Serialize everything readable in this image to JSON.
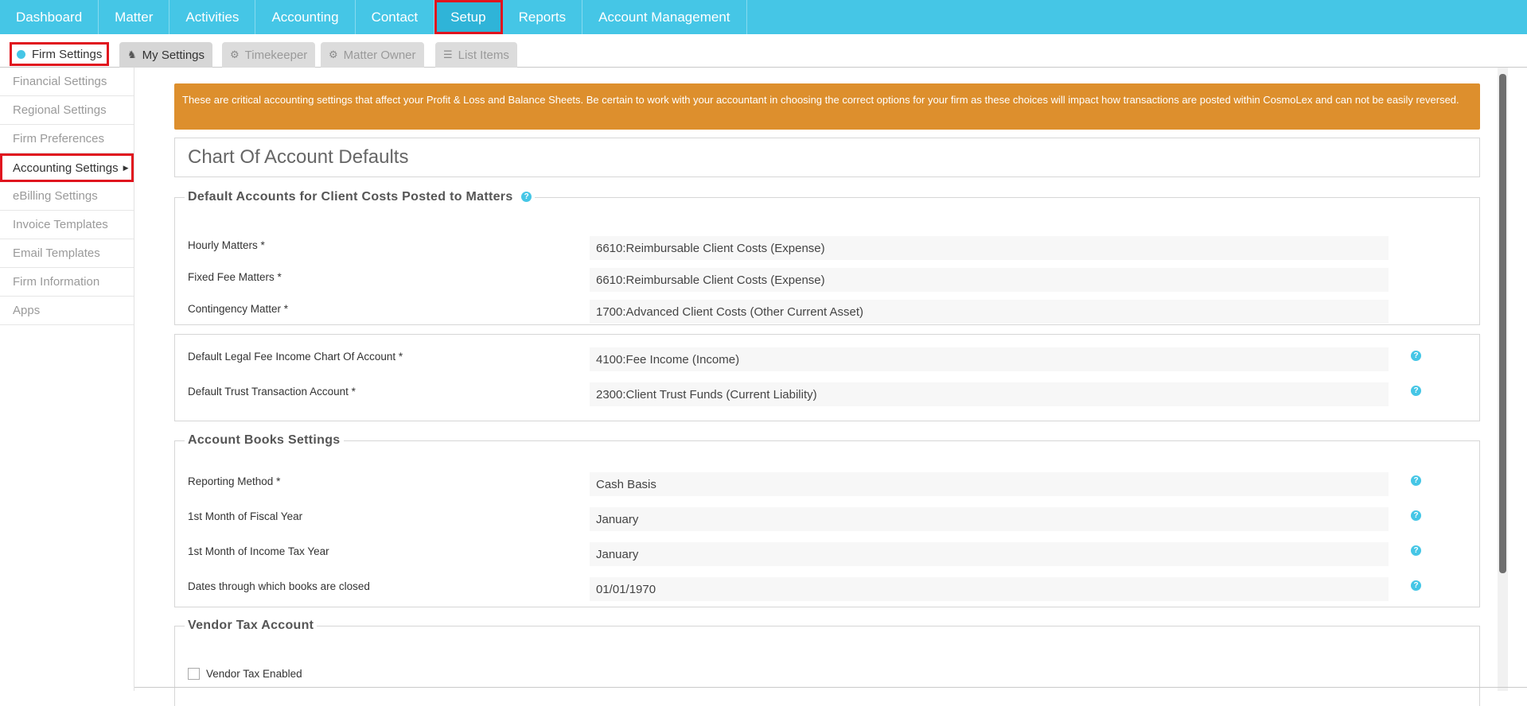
{
  "topnav": {
    "items": [
      "Dashboard",
      "Matter",
      "Activities",
      "Accounting",
      "Contact",
      "Setup",
      "Reports",
      "Account Management"
    ],
    "active": "Setup"
  },
  "subtabs": {
    "firm_settings": "Firm Settings",
    "my_settings": "My Settings",
    "timekeeper": "Timekeeper",
    "matter_owner": "Matter Owner",
    "list_items": "List Items"
  },
  "sidebar": {
    "items": [
      "Financial Settings",
      "Regional Settings",
      "Firm Preferences",
      "Accounting Settings",
      "eBilling Settings",
      "Invoice Templates",
      "Email Templates",
      "Firm Information",
      "Apps"
    ],
    "active": "Accounting Settings"
  },
  "warning": "These are critical accounting settings that affect your Profit & Loss and Balance Sheets. Be certain to work with your accountant in choosing the correct options for your firm as these choices will impact how transactions are posted within CosmoLex and can not be easily reversed.",
  "page_title": "Chart Of Account Defaults",
  "client_costs": {
    "legend": "Default Accounts for Client Costs Posted to Matters",
    "hourly_label": "Hourly Matters *",
    "hourly_value": "6610:Reimbursable Client Costs (Expense)",
    "fixed_label": "Fixed Fee Matters *",
    "fixed_value": "6610:Reimbursable Client Costs (Expense)",
    "contingency_label": "Contingency Matter *",
    "contingency_value": "1700:Advanced Client Costs (Other Current Asset)"
  },
  "defaults": {
    "legal_fee_label": "Default Legal Fee Income Chart Of Account *",
    "legal_fee_value": "4100:Fee Income (Income)",
    "trust_label": "Default Trust Transaction Account *",
    "trust_value": "2300:Client Trust Funds (Current Liability)"
  },
  "books": {
    "legend": "Account Books Settings",
    "reporting_label": "Reporting Method *",
    "reporting_value": "Cash Basis",
    "fiscal_label": "1st Month of Fiscal Year",
    "fiscal_value": "January",
    "tax_label": "1st Month of Income Tax Year",
    "tax_value": "January",
    "closed_label": "Dates through which books are closed",
    "closed_value": "01/01/1970"
  },
  "vendor": {
    "legend": "Vendor Tax Account",
    "checkbox_label": "Vendor Tax Enabled"
  },
  "help_glyph": "?",
  "colors": {
    "nav": "#45c6e6",
    "warning": "#dd8f2d",
    "highlight": "#e0141e"
  }
}
